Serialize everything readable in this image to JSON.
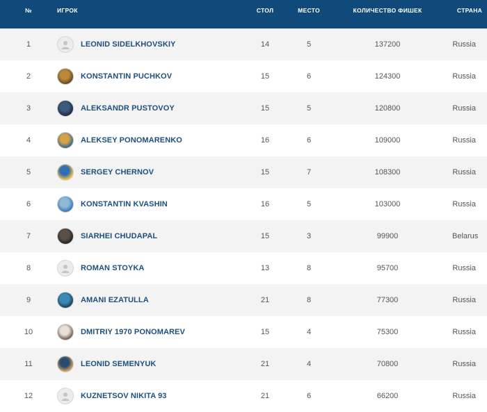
{
  "header": {
    "num": "№",
    "player": "ИГРОК",
    "table": "СТОЛ",
    "seat": "МЕСТО",
    "chips": "КОЛИЧЕСТВО ФИШЕК",
    "country": "СТРАНА"
  },
  "colors": {
    "header_bg": "#0f4a7a",
    "name": "#1d4f7e",
    "alt_row": "#f3f3f3"
  },
  "rows": [
    {
      "num": "1",
      "name": "LEONID SIDELKHOVSKIY",
      "avatar": "placeholder-avatar",
      "table": "14",
      "seat": "5",
      "chips": "137200",
      "country": "Russia"
    },
    {
      "num": "2",
      "name": "KONSTANTIN PUCHKOV",
      "avatar": "photo-avatar",
      "table": "15",
      "seat": "6",
      "chips": "124300",
      "country": "Russia"
    },
    {
      "num": "3",
      "name": "ALEKSANDR PUSTOVOY",
      "avatar": "photo-avatar",
      "table": "15",
      "seat": "5",
      "chips": "120800",
      "country": "Russia"
    },
    {
      "num": "4",
      "name": "ALEKSEY PONOMARENKO",
      "avatar": "photo-avatar",
      "table": "16",
      "seat": "6",
      "chips": "109000",
      "country": "Russia"
    },
    {
      "num": "5",
      "name": "SERGEY CHERNOV",
      "avatar": "photo-avatar",
      "table": "15",
      "seat": "7",
      "chips": "108300",
      "country": "Russia"
    },
    {
      "num": "6",
      "name": "KONSTANTIN KVASHIN",
      "avatar": "photo-avatar",
      "table": "16",
      "seat": "5",
      "chips": "103000",
      "country": "Russia"
    },
    {
      "num": "7",
      "name": "SIARHEI CHUDAPAL",
      "avatar": "photo-avatar",
      "table": "15",
      "seat": "3",
      "chips": "99900",
      "country": "Belarus"
    },
    {
      "num": "8",
      "name": "ROMAN STOYKA",
      "avatar": "placeholder-avatar",
      "table": "13",
      "seat": "8",
      "chips": "95700",
      "country": "Russia"
    },
    {
      "num": "9",
      "name": "AMANI EZATULLA",
      "avatar": "photo-avatar",
      "table": "21",
      "seat": "8",
      "chips": "77300",
      "country": "Russia"
    },
    {
      "num": "10",
      "name": "DMITRIY 1970 PONOMAREV",
      "avatar": "photo-avatar",
      "table": "15",
      "seat": "4",
      "chips": "75300",
      "country": "Russia"
    },
    {
      "num": "11",
      "name": "LEONID SEMENYUK",
      "avatar": "photo-avatar",
      "table": "21",
      "seat": "4",
      "chips": "70800",
      "country": "Russia"
    },
    {
      "num": "12",
      "name": "KUZNETSOV NIKITA 93",
      "avatar": "placeholder-avatar",
      "table": "21",
      "seat": "6",
      "chips": "66200",
      "country": "Russia"
    }
  ]
}
